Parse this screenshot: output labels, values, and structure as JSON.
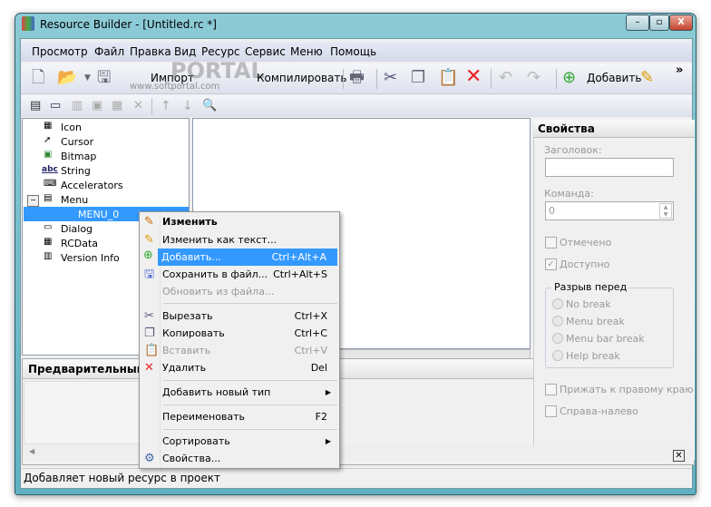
{
  "window": {
    "title": "Resource Builder - [Untitled.rc *]",
    "min": "–",
    "max": "▫",
    "close": "X"
  },
  "menu": [
    "Просмотр",
    "Файл",
    "Правка",
    "Вид",
    "Ресурс",
    "Сервис",
    "Меню",
    "Помощь"
  ],
  "toolbar": {
    "import": "Импорт",
    "compile": "Компилировать",
    "add": "Добавить",
    "more": "»"
  },
  "watermark": {
    "logo": "PORTAL",
    "url": "www.softportal.com"
  },
  "tree": {
    "items": [
      "Icon",
      "Cursor",
      "Bitmap",
      "String",
      "Accelerators",
      "Menu",
      "MENU_0",
      "Dialog",
      "RCData",
      "Version Info"
    ],
    "icons": [
      "abc"
    ]
  },
  "preview": {
    "title": "Предварительный пр"
  },
  "context_menu": [
    {
      "label": "Изменить",
      "shortcut": ""
    },
    {
      "label": "Изменить как текст...",
      "shortcut": ""
    },
    {
      "label": "Добавить...",
      "shortcut": "Ctrl+Alt+A"
    },
    {
      "label": "Сохранить в файл...",
      "shortcut": "Ctrl+Alt+S"
    },
    {
      "label": "Обновить из файла...",
      "shortcut": ""
    },
    {
      "label": "Вырезать",
      "shortcut": "Ctrl+X"
    },
    {
      "label": "Копировать",
      "shortcut": "Ctrl+C"
    },
    {
      "label": "Вставить",
      "shortcut": "Ctrl+V"
    },
    {
      "label": "Удалить",
      "shortcut": "Del"
    },
    {
      "label": "Добавить новый тип",
      "shortcut": ""
    },
    {
      "label": "Переименовать",
      "shortcut": "F2"
    },
    {
      "label": "Сортировать",
      "shortcut": ""
    },
    {
      "label": "Свойства...",
      "shortcut": ""
    }
  ],
  "properties": {
    "title": "Свойства",
    "caption_label": "Заголовок:",
    "caption_value": "",
    "command_label": "Команда:",
    "command_value": "0",
    "checked": "Отмечено",
    "enabled": "Доступно",
    "break_group": "Разрыв перед",
    "breaks": [
      "No break",
      "Menu break",
      "Menu bar break",
      "Help break"
    ],
    "right_justify": "Прижать к правому краю",
    "rtl": "Справа-налево"
  },
  "status": "Добавляет новый ресурс в проект"
}
